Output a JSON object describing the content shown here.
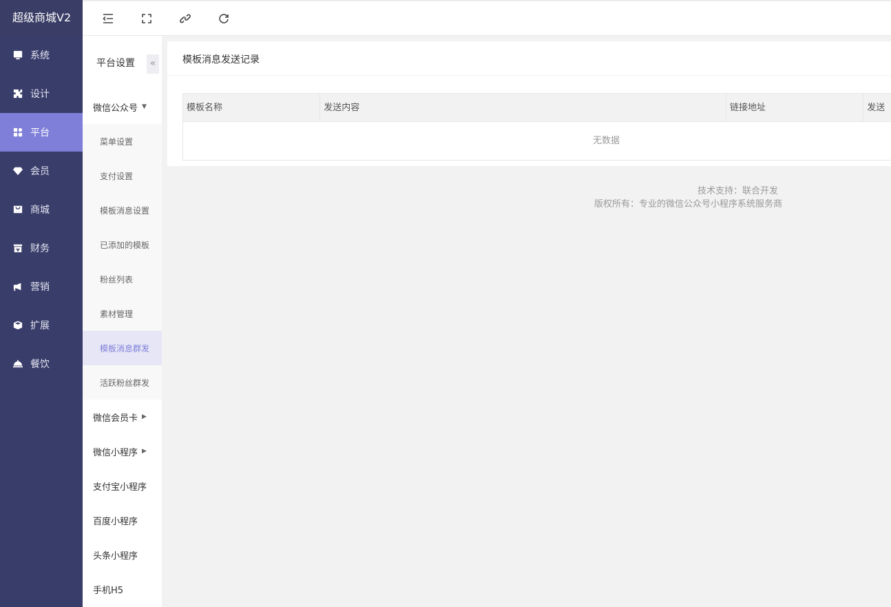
{
  "brand": "超级商城V2",
  "nav": [
    {
      "label": "系统",
      "icon": "monitor-icon"
    },
    {
      "label": "设计",
      "icon": "puzzle-icon"
    },
    {
      "label": "平台",
      "icon": "grid-icon",
      "active": true
    },
    {
      "label": "会员",
      "icon": "gem-icon"
    },
    {
      "label": "商城",
      "icon": "shop-icon"
    },
    {
      "label": "财务",
      "icon": "wallet-icon"
    },
    {
      "label": "营销",
      "icon": "bullhorn-icon"
    },
    {
      "label": "扩展",
      "icon": "cube-icon"
    },
    {
      "label": "餐饮",
      "icon": "cloche-icon"
    }
  ],
  "sub": {
    "title": "平台设置",
    "collapse": "«",
    "group_wechat": "微信公众号",
    "wechat_items": [
      "菜单设置",
      "支付设置",
      "模板消息设置",
      "已添加的模板",
      "粉丝列表",
      "素材管理",
      "模板消息群发",
      "活跃粉丝群发"
    ],
    "group_card": "微信会员卡",
    "group_mini": "微信小程序",
    "alipay": "支付宝小程序",
    "baidu": "百度小程序",
    "toutiao": "头条小程序",
    "h5": "手机H5"
  },
  "main": {
    "title": "模板消息发送记录",
    "columns": [
      "模板名称",
      "发送内容",
      "链接地址",
      "发送"
    ],
    "empty": "无数据"
  },
  "footer": {
    "line1": "技术支持：联合开发",
    "line2": "版权所有：专业的微信公众号小程序系统服务商"
  },
  "colors": {
    "sidebar": "#393D6A",
    "accent": "#7F7FD9"
  }
}
